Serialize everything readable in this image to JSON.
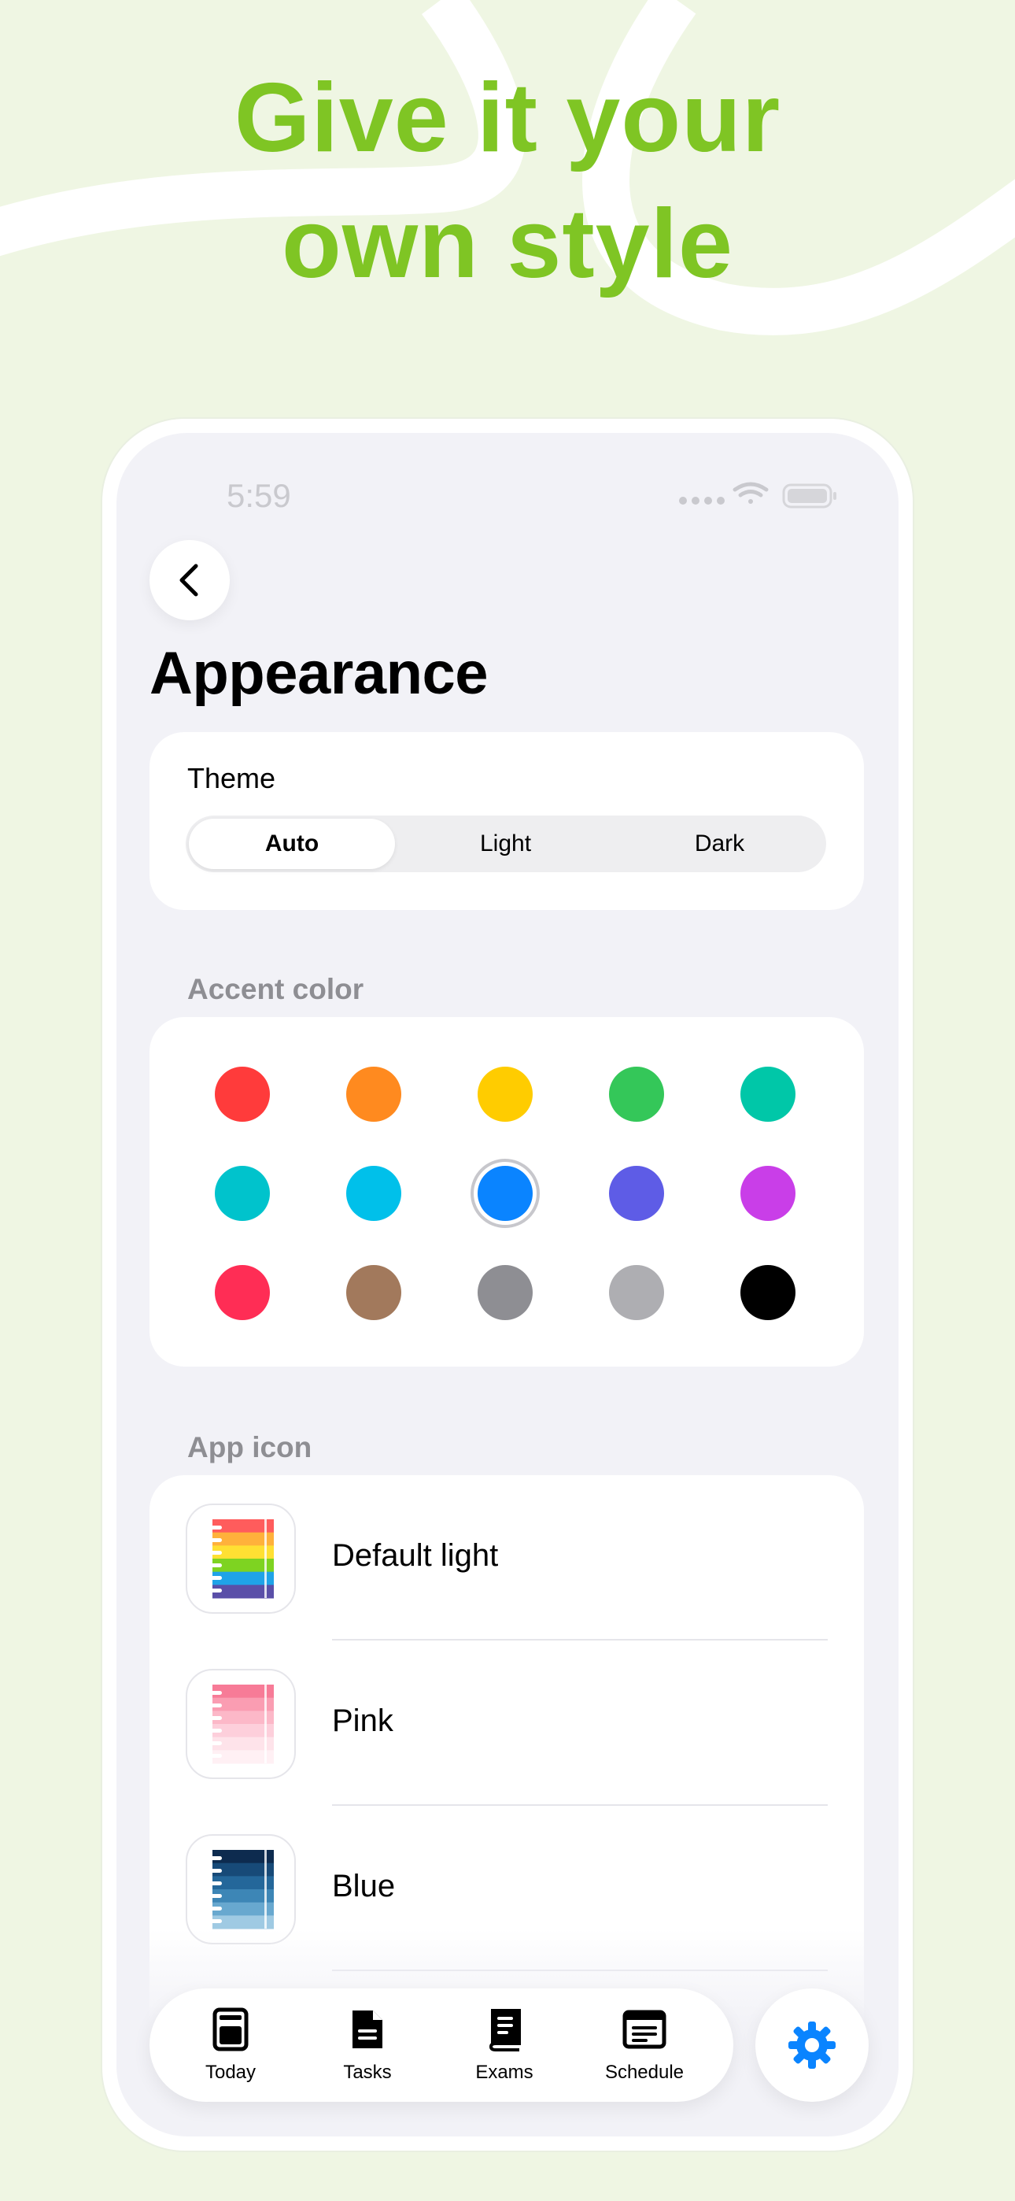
{
  "headline": {
    "line1": "Give it your",
    "line2": "own style"
  },
  "colors": {
    "headline": "#7fc524",
    "background": "#eff6e3",
    "selected_accent": "#0a84ff"
  },
  "status_bar": {
    "time": "5:59",
    "icons": [
      "signal-dots-icon",
      "wifi-icon",
      "battery-icon"
    ]
  },
  "nav": {
    "back_icon": "chevron-left-icon"
  },
  "page": {
    "title": "Appearance"
  },
  "theme": {
    "label": "Theme",
    "options": [
      "Auto",
      "Light",
      "Dark"
    ],
    "selected": "Auto"
  },
  "accent": {
    "header": "Accent color",
    "swatches": [
      "#ff3b3b",
      "#ff8a1f",
      "#ffcc00",
      "#34c759",
      "#00c7a8",
      "#00c3cc",
      "#00c0ea",
      "#0a84ff",
      "#5e5ce6",
      "#c93ee8",
      "#ff2d55",
      "#a2795c",
      "#8e8e93",
      "#aeaeb2",
      "#000000"
    ],
    "selected_index": 7
  },
  "app_icon": {
    "header": "App icon",
    "items": [
      {
        "label": "Default light",
        "stripes": [
          "#ff5c5c",
          "#ffb13b",
          "#ffe033",
          "#7ed321",
          "#1fa3e8",
          "#5a4fa8"
        ]
      },
      {
        "label": "Pink",
        "stripes": [
          "#f77b97",
          "#fa9db2",
          "#fcb8c8",
          "#fdcfdb",
          "#fee3ea",
          "#fff0f4"
        ]
      },
      {
        "label": "Blue",
        "stripes": [
          "#0d2b4f",
          "#174a78",
          "#24679a",
          "#3d86b6",
          "#68a8cf",
          "#9fcae3"
        ]
      }
    ]
  },
  "tabbar": {
    "tabs": [
      {
        "label": "Today",
        "icon": "today-icon"
      },
      {
        "label": "Tasks",
        "icon": "document-icon"
      },
      {
        "label": "Exams",
        "icon": "book-icon"
      },
      {
        "label": "Schedule",
        "icon": "schedule-icon"
      }
    ],
    "settings_icon": "gear-icon"
  }
}
